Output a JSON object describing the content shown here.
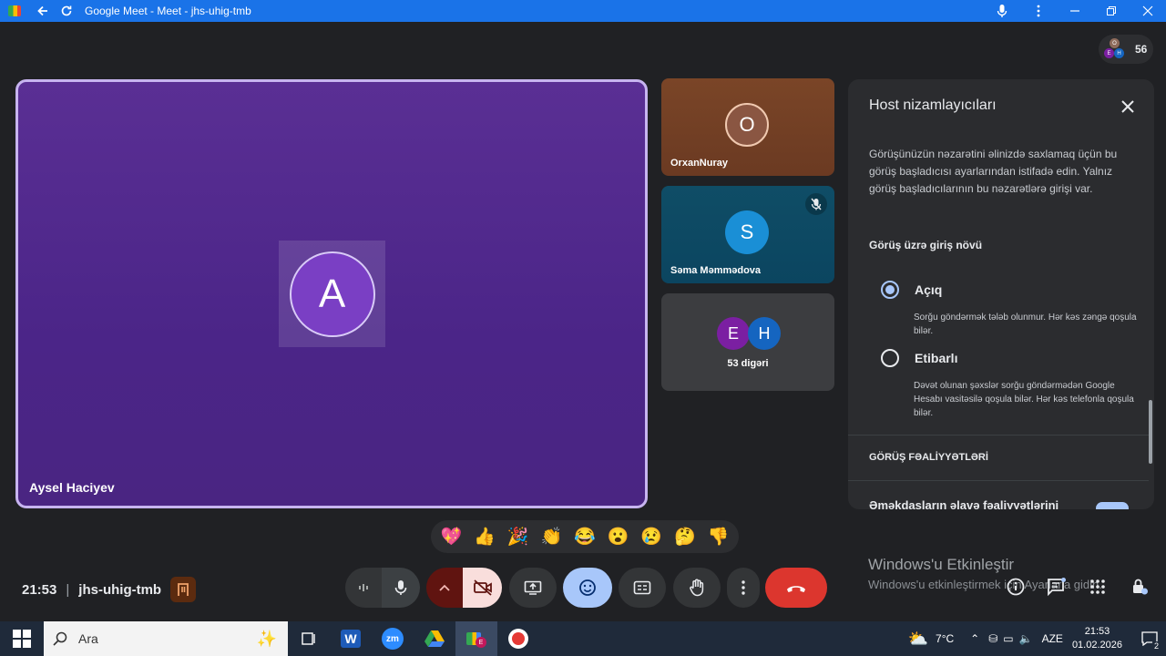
{
  "window": {
    "title": "Google Meet - Meet - jhs-uhig-tmb"
  },
  "participants_count": "56",
  "main_tile": {
    "avatar_letter": "A",
    "name": "Aysel Haciyev"
  },
  "side_tiles": [
    {
      "avatar_letter": "O",
      "name": "OrxanNuray"
    },
    {
      "avatar_letter": "S",
      "name": "Səma Məmmədova",
      "muted": true
    },
    {
      "avatars": [
        "E",
        "H"
      ],
      "name": "53 digəri"
    }
  ],
  "host_panel": {
    "title": "Host nizamlayıcıları",
    "description": "Görüşünüzün nəzarətini əlinizdə saxlamaq üçün bu görüş başladıcısı ayarlarından istifadə edin. Yalnız görüş başladıcılarının bu nəzarətlərə girişi var.",
    "access_type_heading": "Görüş üzrə giriş növü",
    "options": [
      {
        "label": "Açıq",
        "description": "Sorğu göndərmək tələb olunmur. Hər kəs zəngə qoşula bilər.",
        "selected": true
      },
      {
        "label": "Etibarlı",
        "description": "Dəvət olunan şəxslər sorğu göndərmədən Google Hesabı vasitəsilə qoşula bilər. Hər kəs telefonla qoşula bilər.",
        "selected": false
      }
    ],
    "activities_heading": "GÖRÜŞ FƏALİYYƏTLƏRİ",
    "partial_item": "Əməkdaşların əlavə fəaliyyətlərini"
  },
  "reactions": [
    "💖",
    "👍",
    "🎉",
    "👏",
    "😂",
    "😮",
    "😢",
    "🤔",
    "👎"
  ],
  "meeting": {
    "time": "21:53",
    "separator": "|",
    "code": "jhs-uhig-tmb"
  },
  "watermark": {
    "line1": "Windows'u Etkinleştir",
    "line2": "Windows'u etkinleştirmek için Ayarlar'a gidin."
  },
  "taskbar": {
    "search_placeholder": "Ara",
    "weather": "7°C",
    "language": "AZE",
    "time": "21:53",
    "date": "01.02.2026",
    "notifications": "2"
  },
  "colors": {
    "accent": "#1a73e8",
    "main_tile_bg": "#4b2588",
    "hangup": "#ea4335",
    "camera_off": "#f9dedc",
    "reactions_active": "#a8c7fa"
  }
}
